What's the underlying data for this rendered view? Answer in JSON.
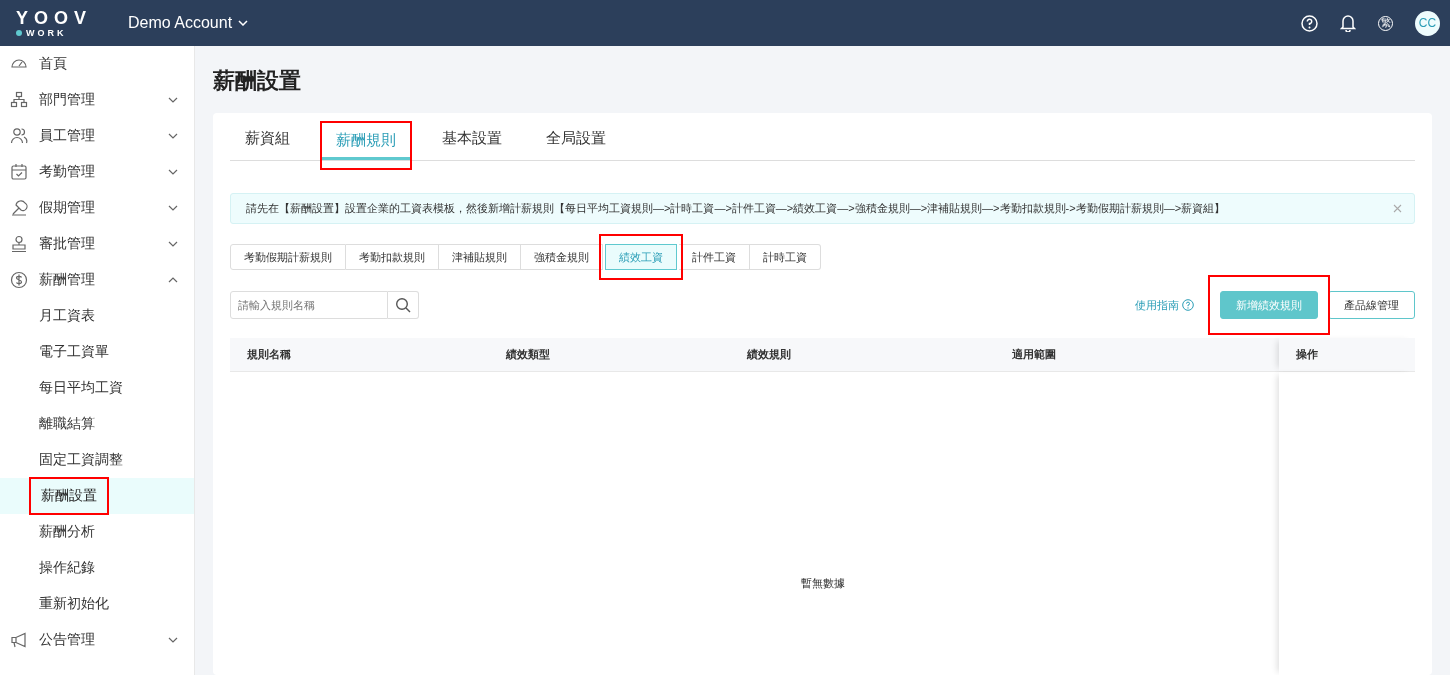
{
  "topbar": {
    "logo_top": "YOOV",
    "logo_bottom": "WORK",
    "account": "Demo Account",
    "language_badge": "繁",
    "avatar": "CC"
  },
  "sidebar": {
    "items": [
      {
        "label": "首頁",
        "selected": false
      },
      {
        "label": "部門管理",
        "selected": false,
        "expanded": false
      },
      {
        "label": "員工管理",
        "selected": false,
        "expanded": false
      },
      {
        "label": "考勤管理",
        "selected": false,
        "expanded": false
      },
      {
        "label": "假期管理",
        "selected": false,
        "expanded": false
      },
      {
        "label": "審批管理",
        "selected": false,
        "expanded": false
      },
      {
        "label": "薪酬管理",
        "selected": false,
        "expanded": true,
        "children": [
          {
            "label": "月工資表",
            "selected": false,
            "annotated": false
          },
          {
            "label": "電子工資單",
            "selected": false,
            "annotated": false
          },
          {
            "label": "每日平均工資",
            "selected": false,
            "annotated": false
          },
          {
            "label": "離職結算",
            "selected": false,
            "annotated": false
          },
          {
            "label": "固定工資調整",
            "selected": false,
            "annotated": false
          },
          {
            "label": "薪酬設置",
            "selected": true,
            "annotated": true
          },
          {
            "label": "薪酬分析",
            "selected": false,
            "annotated": false
          },
          {
            "label": "操作紀錄",
            "selected": false,
            "annotated": false
          },
          {
            "label": "重新初始化",
            "selected": false,
            "annotated": false
          }
        ]
      },
      {
        "label": "公告管理",
        "selected": false,
        "expanded": false
      }
    ]
  },
  "page_title": "薪酬設置",
  "tabs": [
    {
      "label": "薪資組",
      "selected": false,
      "annotated": false
    },
    {
      "label": "薪酬規則",
      "selected": true,
      "annotated": true
    },
    {
      "label": "基本設置",
      "selected": false,
      "annotated": false
    },
    {
      "label": "全局設置",
      "selected": false,
      "annotated": false
    }
  ],
  "notice": "請先在【薪酬設置】設置企業的工資表模板，然後新增計薪規則【每日平均工資規則—>計時工資—>計件工資—>績效工資—>強積金規則—>津補貼規則—>考勤扣款規則->考勤假期計薪規則—>薪資組】",
  "rule_tabs": [
    {
      "label": "考勤假期計薪規則",
      "selected": false,
      "annotated": false
    },
    {
      "label": "考勤扣款規則",
      "selected": false,
      "annotated": false
    },
    {
      "label": "津補貼規則",
      "selected": false,
      "annotated": false
    },
    {
      "label": "強積金規則",
      "selected": false,
      "annotated": false
    },
    {
      "label": "績效工資",
      "selected": true,
      "annotated": true
    },
    {
      "label": "計件工資",
      "selected": false,
      "annotated": false
    },
    {
      "label": "計時工資",
      "selected": false,
      "annotated": false
    }
  ],
  "search": {
    "placeholder": "請輸入規則名稱"
  },
  "guide_link": "使用指南",
  "buttons": [
    {
      "label": "新增績效規則",
      "kind": "primary",
      "annotated": true
    },
    {
      "label": "產品線管理",
      "kind": "outline",
      "annotated": false
    }
  ],
  "table": {
    "columns": [
      "規則名稱",
      "績效類型",
      "績效規則",
      "適用範圍",
      "操作"
    ],
    "empty_text": "暫無數據"
  }
}
